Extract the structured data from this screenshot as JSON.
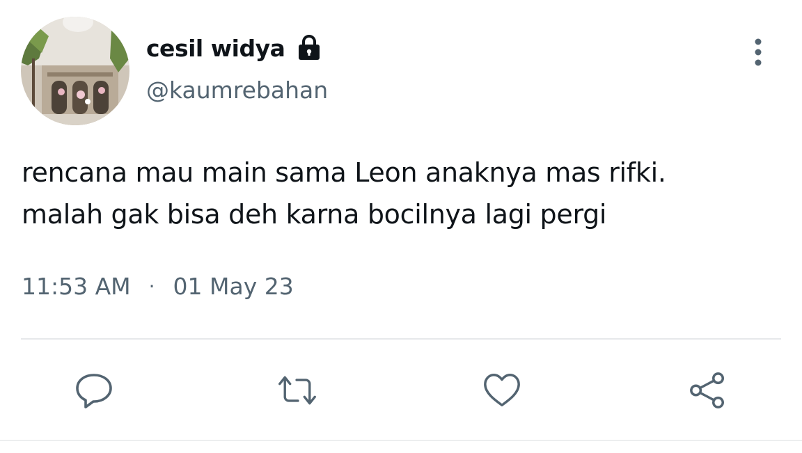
{
  "author": {
    "display_name": "cesil widya",
    "handle": "@kaumrebahan",
    "protected_icon": "lock-icon",
    "avatar_icon": "avatar-photo"
  },
  "tweet": {
    "text_line_1": "rencana mau main sama Leon anaknya mas rifki.",
    "text_line_2": "malah gak bisa deh karna bocilnya lagi pergi",
    "time": "11:53 AM",
    "separator": "·",
    "date": "01 May 23"
  },
  "actions": {
    "reply_icon": "reply-icon",
    "retweet_icon": "retweet-icon",
    "like_icon": "heart-icon",
    "share_icon": "share-icon",
    "more_icon": "more-vertical-icon"
  },
  "colors": {
    "text_primary": "#0f1419",
    "text_secondary": "#536471",
    "divider": "#e6e8ea"
  }
}
